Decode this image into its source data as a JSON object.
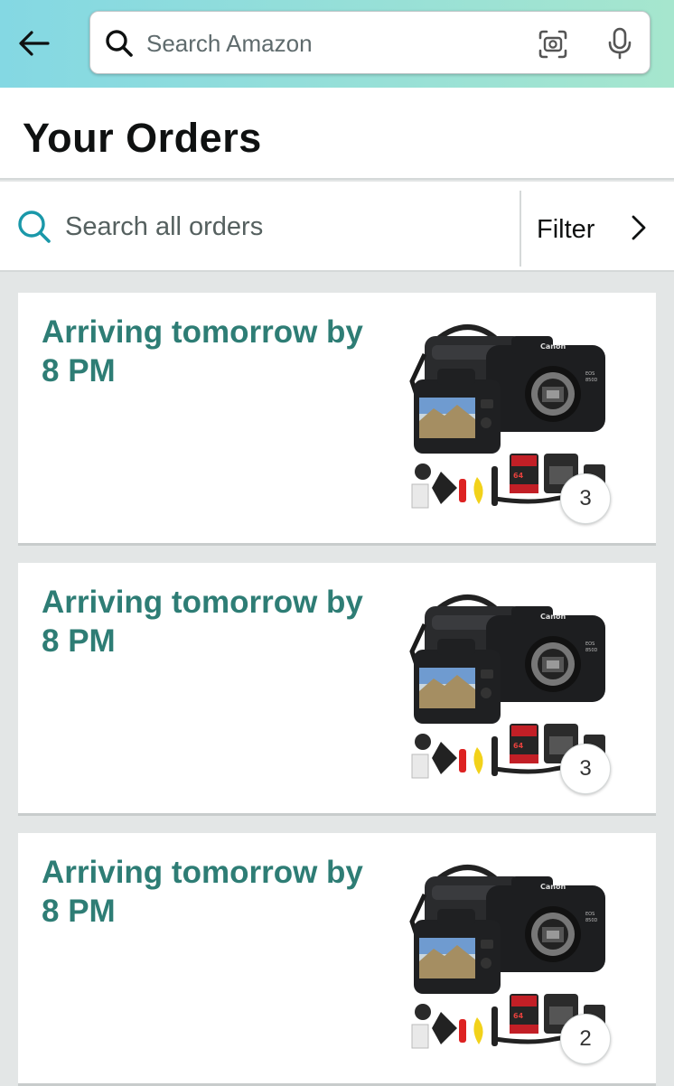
{
  "header": {
    "search_placeholder": "Search Amazon",
    "icons": [
      "back-arrow-icon",
      "search-icon",
      "camera-scan-icon",
      "microphone-icon"
    ]
  },
  "page": {
    "title": "Your Orders",
    "orders_search_placeholder": "Search all orders",
    "filter_label": "Filter"
  },
  "orders": [
    {
      "status": "Arriving tomorrow by 8 PM",
      "item_count": "3"
    },
    {
      "status": "Arriving tomorrow by 8 PM",
      "item_count": "3"
    },
    {
      "status": "Arriving tomorrow by 8 PM",
      "item_count": "2"
    }
  ],
  "colors": {
    "header_gradient_start": "#84d8e3",
    "header_gradient_end": "#a6e6ce",
    "status_green": "#2e7d75",
    "search_teal": "#1a98a9",
    "page_bg": "#e3e6e6"
  }
}
